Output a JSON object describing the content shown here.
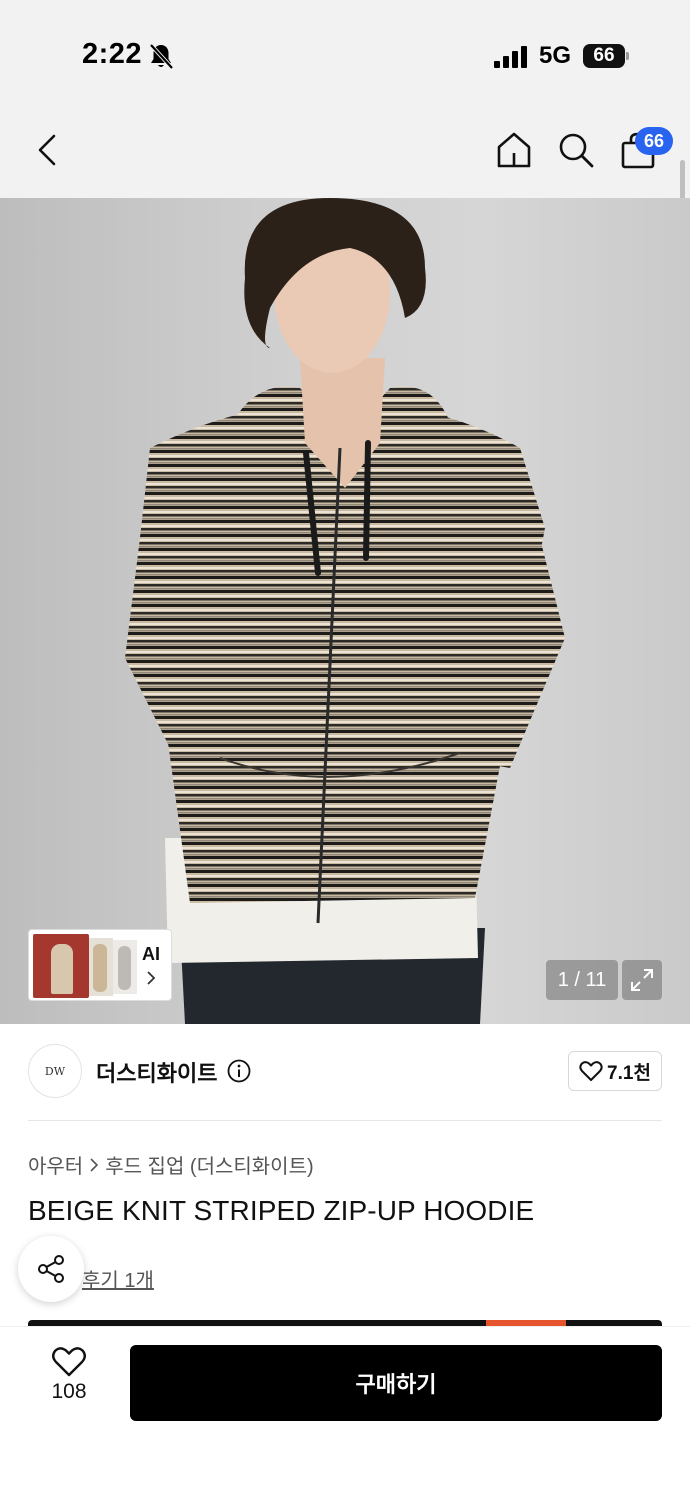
{
  "status_bar": {
    "time": "2:22",
    "network": "5G",
    "battery": "66"
  },
  "nav": {
    "cart_badge": "66"
  },
  "image": {
    "ai_label": "AI",
    "counter": "1 / 11"
  },
  "brand": {
    "name": "더스티화이트",
    "logo_text": "DW",
    "likes": "7.1천"
  },
  "product": {
    "breadcrumb": [
      "아우터",
      "후드 집업 (더스티화이트)"
    ],
    "title": "BEIGE KNIT STRIPED ZIP-UP HOODIE",
    "review_link": "후기 1개"
  },
  "bottom": {
    "wish_count": "108",
    "buy_label": "구매하기"
  },
  "colors": {
    "badge": "#2864f0",
    "buy_button": "#000000",
    "accent": "#e5542c"
  },
  "icons": [
    "bell-slash-icon",
    "back-icon",
    "home-icon",
    "search-icon",
    "bag-icon",
    "expand-icon",
    "info-icon",
    "heart-icon",
    "share-icon",
    "chevron-right-icon"
  ]
}
